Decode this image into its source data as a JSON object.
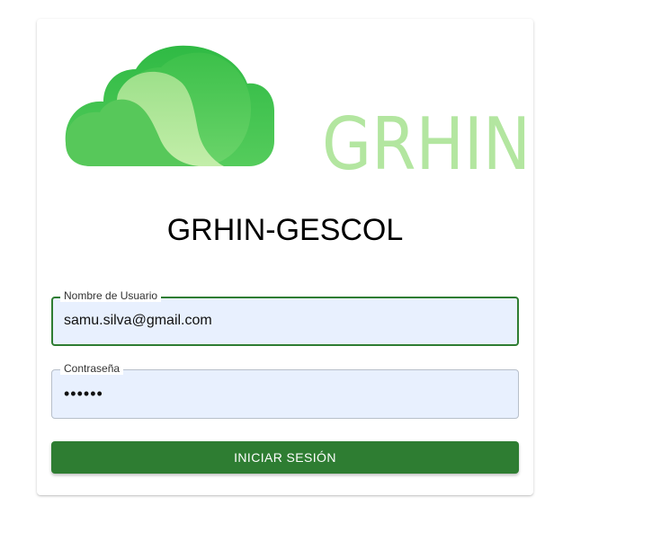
{
  "logo": {
    "text": "GRHIN",
    "cloud_colors": {
      "back_light": "#4fcb5a",
      "back_dark": "#2eb84a",
      "front_light": "#b5e89c",
      "text": "#b3e6a0"
    }
  },
  "title": "GRHIN-GESCOL",
  "username_field": {
    "label": "Nombre de Usuario",
    "value": "samu.silva@gmail.com"
  },
  "password_field": {
    "label": "Contraseña",
    "value": "••••••"
  },
  "login_button": {
    "label": "INICIAR SESIÓN"
  },
  "colors": {
    "primary": "#2e7d32",
    "input_bg": "#e8f0fe"
  }
}
